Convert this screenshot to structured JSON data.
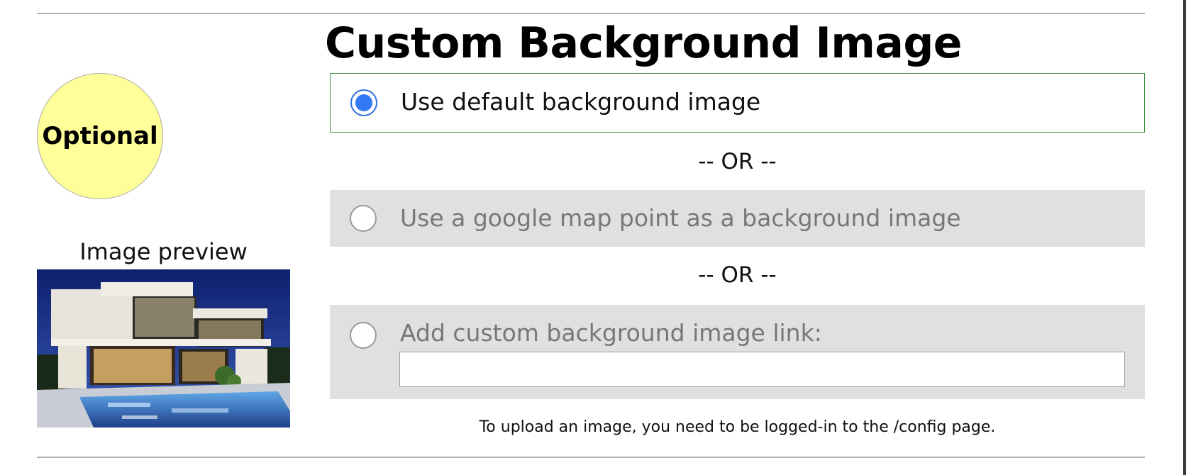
{
  "section": {
    "title": "Custom Background Image",
    "badge": "Optional"
  },
  "preview": {
    "label": "Image preview"
  },
  "options": [
    {
      "label": "Use default background image",
      "selected": true,
      "enabled": true
    },
    {
      "label": "Use a google map point as a background image",
      "selected": false,
      "enabled": false
    },
    {
      "label": "Add custom background image link:",
      "selected": false,
      "enabled": false
    }
  ],
  "separator": "-- OR --",
  "custom_link_input": {
    "value": "",
    "placeholder": ""
  },
  "note": "To upload an image, you need to be logged-in to the /config page.",
  "colors": {
    "badge_bg": "#ffff99",
    "selected_border": "#3c8f3c",
    "disabled_bg": "#e0e0e0",
    "radio_accent": "#3478f6"
  }
}
